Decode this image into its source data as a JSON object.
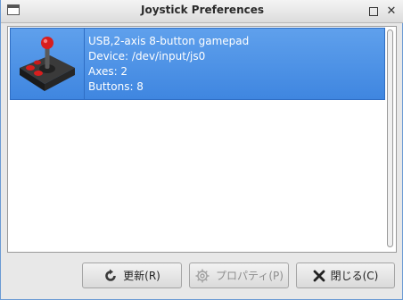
{
  "window": {
    "title": "Joystick Preferences"
  },
  "titlebar": {
    "maximize_icon": "maximize-icon",
    "close_glyph": "✕"
  },
  "devices": [
    {
      "icon": "joystick-icon",
      "name": "USB,2-axis 8-button gamepad",
      "device": "Device: /dev/input/js0",
      "axes": "Axes: 2",
      "buttons": "Buttons: 8"
    }
  ],
  "buttons": {
    "refresh": {
      "label": "更新(R)",
      "icon": "refresh-icon"
    },
    "properties": {
      "label": "プロパティ(P)",
      "icon": "gear-icon",
      "disabled": true
    },
    "close": {
      "label": "閉じる(C)",
      "icon": "close-x-icon"
    }
  },
  "colors": {
    "selection": "#4a90e2",
    "selection_text": "#ffffff",
    "joystick_red": "#d81e1e"
  }
}
